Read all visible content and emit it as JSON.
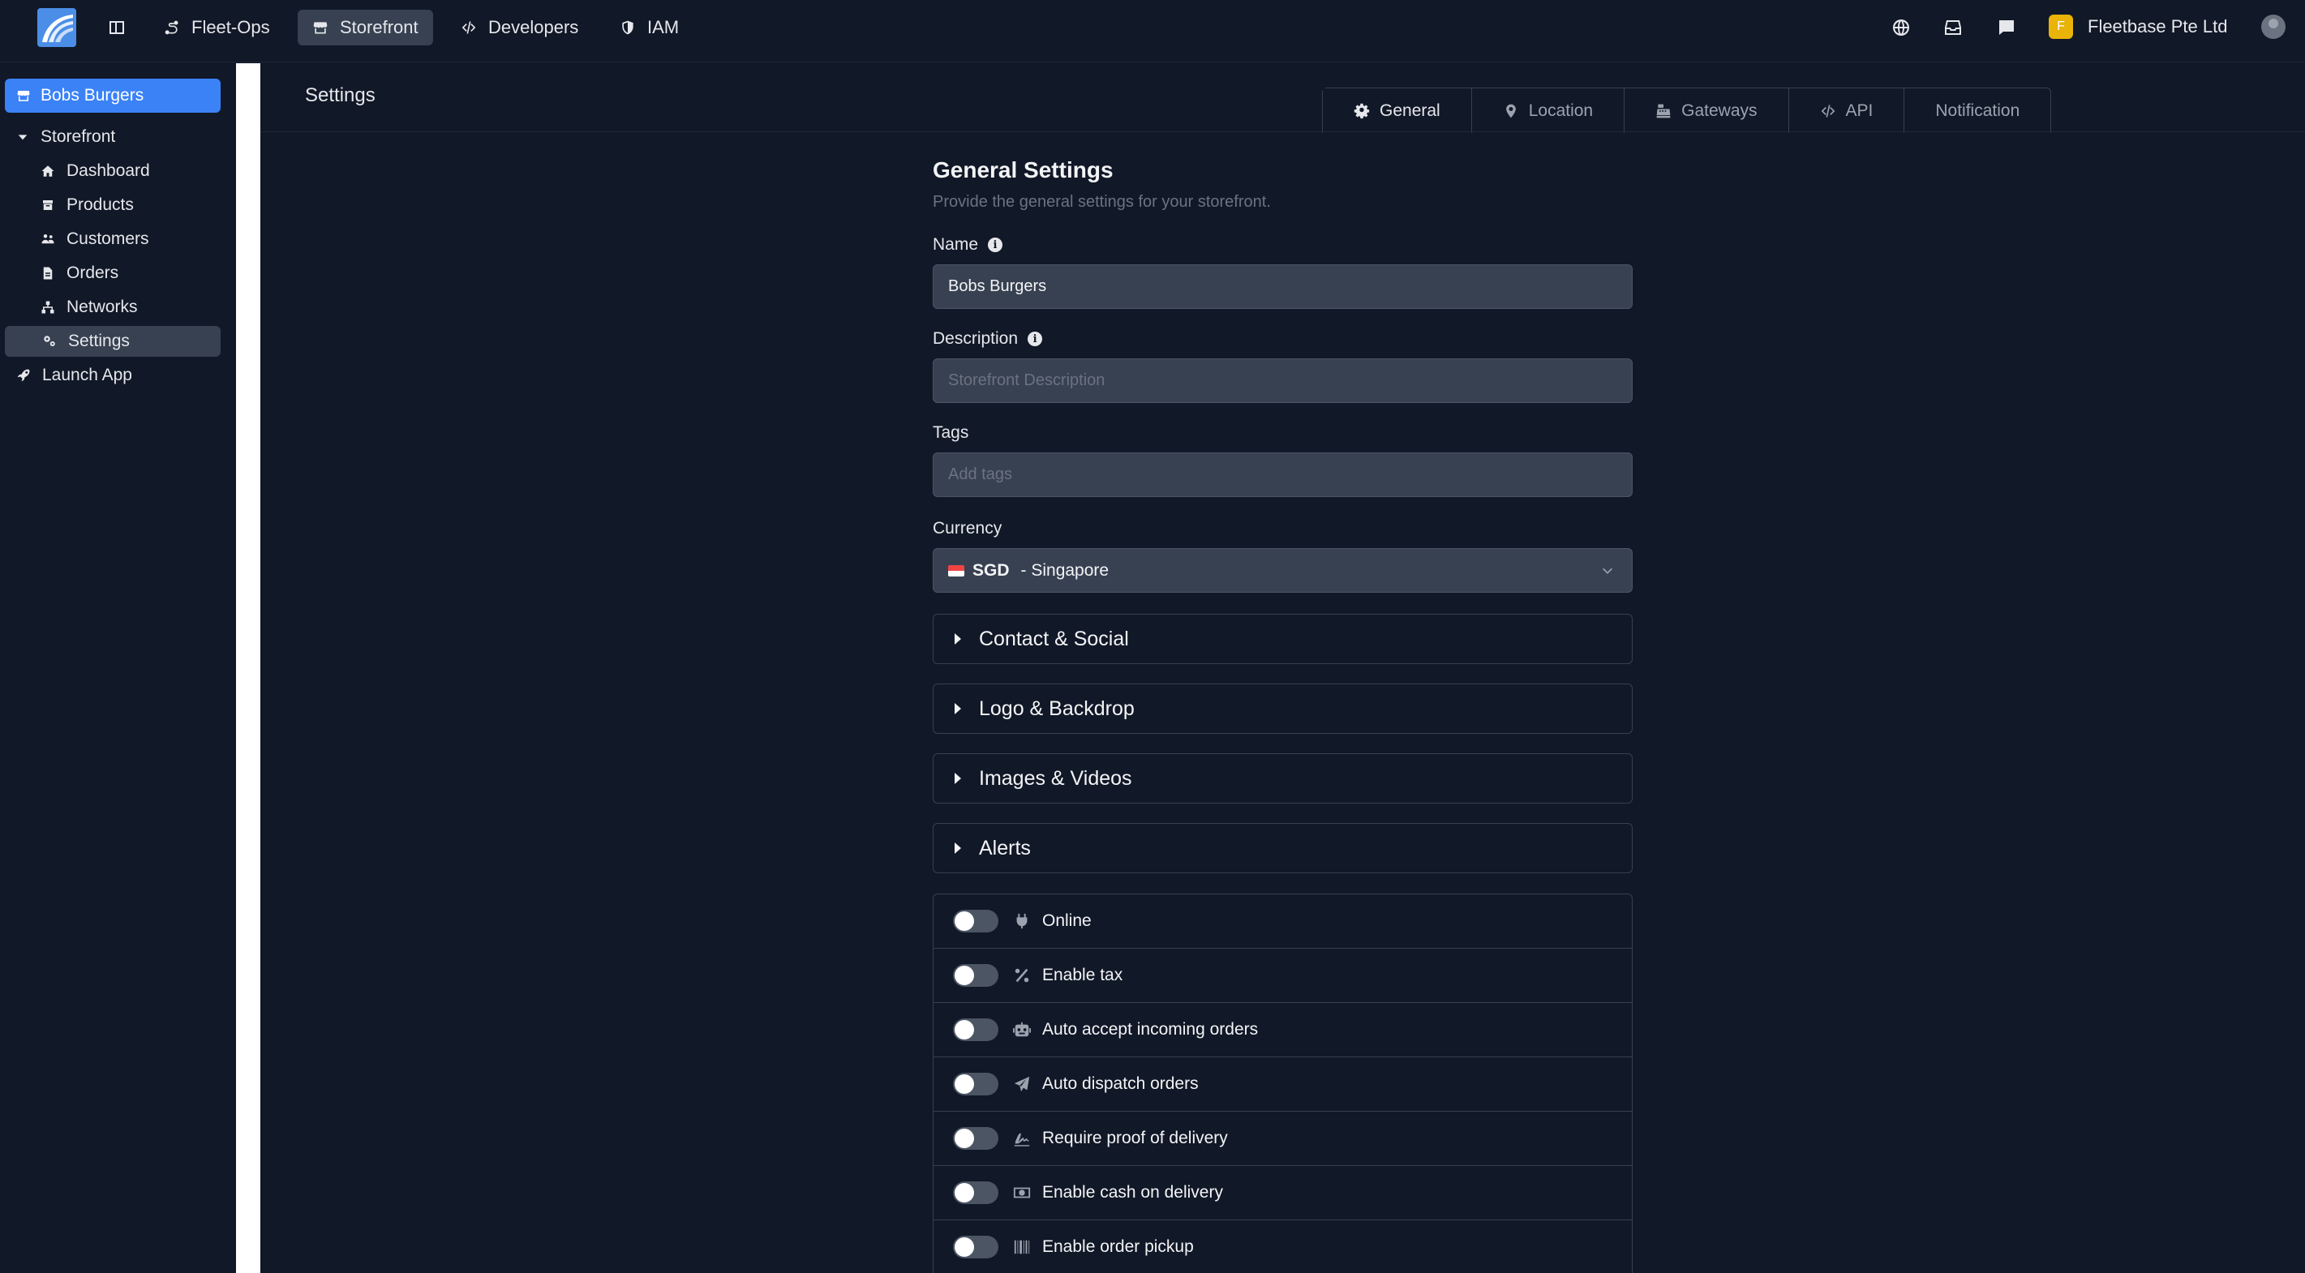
{
  "topbar": {
    "nav": [
      {
        "label": "Fleet-Ops",
        "icon": "route-icon"
      },
      {
        "label": "Storefront",
        "icon": "store-icon"
      },
      {
        "label": "Developers",
        "icon": "code-icon"
      },
      {
        "label": "IAM",
        "icon": "shield-icon"
      }
    ],
    "org_initial": "F",
    "org_name": "Fleetbase Pte Ltd"
  },
  "sidebar": {
    "store_name": "Bobs Burgers",
    "section": "Storefront",
    "items": [
      {
        "label": "Dashboard",
        "icon": "home-icon"
      },
      {
        "label": "Products",
        "icon": "box-icon"
      },
      {
        "label": "Customers",
        "icon": "users-icon"
      },
      {
        "label": "Orders",
        "icon": "file-icon"
      },
      {
        "label": "Networks",
        "icon": "network-icon"
      },
      {
        "label": "Settings",
        "icon": "cogs-icon"
      }
    ],
    "launch": "Launch App"
  },
  "main": {
    "title": "Settings",
    "tabs": [
      {
        "label": "General",
        "icon": "gear-icon"
      },
      {
        "label": "Location",
        "icon": "pin-icon"
      },
      {
        "label": "Gateways",
        "icon": "cash-register-icon"
      },
      {
        "label": "API",
        "icon": "code-icon"
      },
      {
        "label": "Notification",
        "icon": ""
      }
    ],
    "active_tab": "General"
  },
  "form": {
    "title": "General Settings",
    "subtitle": "Provide the general settings for your storefront.",
    "name_label": "Name",
    "name_value": "Bobs Burgers",
    "description_label": "Description",
    "description_placeholder": "Storefront Description",
    "tags_label": "Tags",
    "tags_placeholder": "Add tags",
    "currency_label": "Currency",
    "currency_code": "SGD",
    "currency_country": "- Singapore",
    "accordions": [
      "Contact & Social",
      "Logo & Backdrop",
      "Images & Videos",
      "Alerts"
    ],
    "toggles": [
      {
        "label": "Online",
        "icon": "plug-icon",
        "on": false
      },
      {
        "label": "Enable tax",
        "icon": "percent-icon",
        "on": false
      },
      {
        "label": "Auto accept incoming orders",
        "icon": "robot-icon",
        "on": false
      },
      {
        "label": "Auto dispatch orders",
        "icon": "paper-plane-icon",
        "on": false
      },
      {
        "label": "Require proof of delivery",
        "icon": "signature-icon",
        "on": false
      },
      {
        "label": "Enable cash on delivery",
        "icon": "money-bill-icon",
        "on": false
      },
      {
        "label": "Enable order pickup",
        "icon": "barcode-icon",
        "on": false
      }
    ]
  }
}
